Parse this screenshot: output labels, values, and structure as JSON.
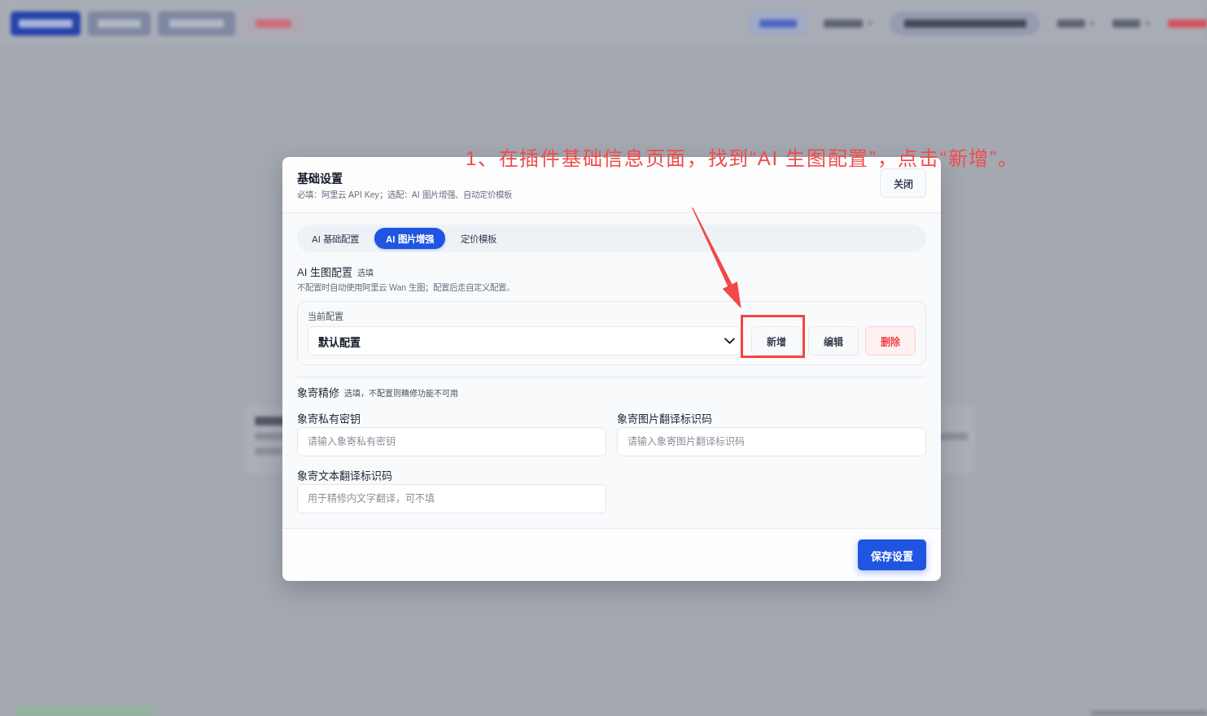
{
  "background": {
    "blurred": true,
    "toolbar_left": [
      {
        "kind": "primary"
      },
      {
        "kind": "muted"
      },
      {
        "kind": "muted"
      },
      {
        "kind": "danger"
      }
    ],
    "toolbar_right": [
      {
        "kind": "outline"
      },
      {
        "kind": "menu"
      },
      {
        "kind": "pill"
      },
      {
        "kind": "menu"
      },
      {
        "kind": "menu"
      },
      {
        "kind": "link"
      }
    ],
    "content": [
      {
        "kind": "card"
      }
    ],
    "footer": [
      {
        "kind": "badge"
      },
      {
        "kind": "text"
      }
    ]
  },
  "dialog": {
    "title": "基础设置",
    "subtitle": "必填：阿里云 API Key；选配：AI 图片增强、自动定价模板",
    "close_button": "关闭",
    "tabs": [
      {
        "label": "AI 基础配置",
        "selected": false
      },
      {
        "label": "AI 图片增强",
        "selected": true
      },
      {
        "label": "定价模板",
        "selected": false
      }
    ],
    "image_generation": {
      "title": "AI 生图配置",
      "tag": "选填",
      "description": "不配置时自动使用阿里云 Wan 生图；配置后走自定义配置。",
      "card": {
        "label": "当前配置",
        "select_value": "默认配置",
        "buttons": [
          {
            "label": "新增",
            "kind": "add",
            "highlighted": true
          },
          {
            "label": "编辑",
            "kind": "edit",
            "highlighted": false
          },
          {
            "label": "删除",
            "kind": "delete",
            "highlighted": false
          }
        ]
      }
    },
    "xiangji": {
      "title": "象寄精修",
      "note": "选填，不配置则精修功能不可用",
      "fields": [
        {
          "label": "象寄私有密钥",
          "placeholder": "请输入象寄私有密钥"
        },
        {
          "label": "象寄图片翻译标识码",
          "placeholder": "请输入象寄图片翻译标识码"
        },
        {
          "label": "象寄文本翻译标识码",
          "placeholder": "用于精修内文字翻译，可不填"
        }
      ]
    },
    "save_button": "保存设置"
  },
  "annotation": {
    "text": "1、在插件基础信息页面，找到“AI 生图配置”，点击“新增”。",
    "arrow": true
  }
}
